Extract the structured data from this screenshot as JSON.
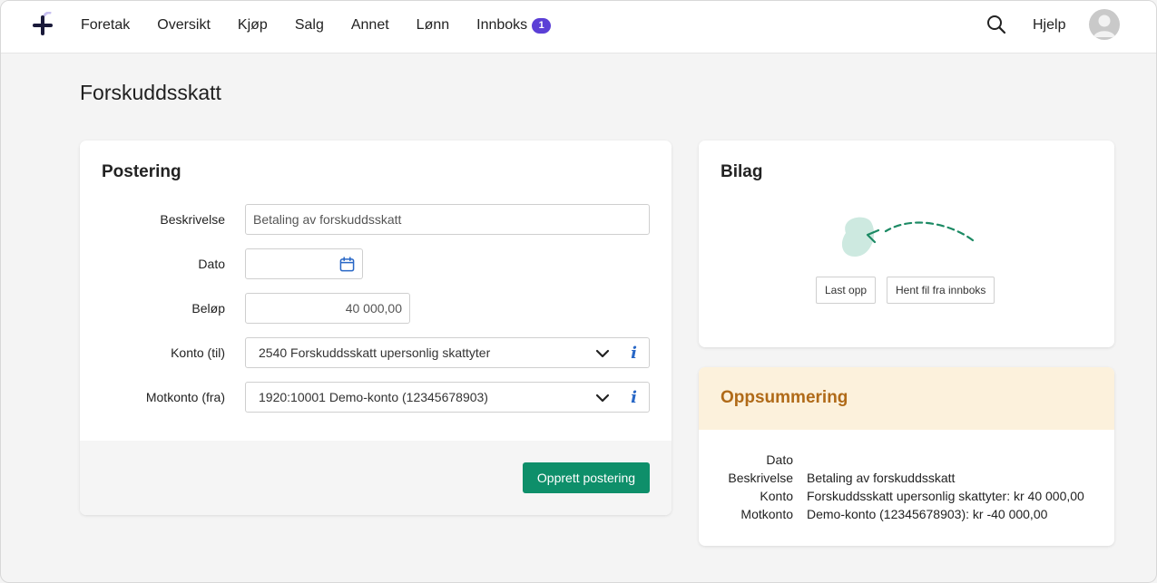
{
  "nav": {
    "items": [
      {
        "label": "Foretak"
      },
      {
        "label": "Oversikt"
      },
      {
        "label": "Kjøp"
      },
      {
        "label": "Salg"
      },
      {
        "label": "Annet"
      },
      {
        "label": "Lønn"
      },
      {
        "label": "Innboks",
        "badge": "1"
      }
    ],
    "help_label": "Hjelp"
  },
  "page": {
    "title": "Forskuddsskatt"
  },
  "postering": {
    "title": "Postering",
    "fields": {
      "beskrivelse_label": "Beskrivelse",
      "beskrivelse_value": "Betaling av forskuddsskatt",
      "dato_label": "Dato",
      "dato_value": "",
      "belop_label": "Beløp",
      "belop_value": "40 000,00",
      "konto_label": "Konto (til)",
      "konto_value": "2540 Forskuddsskatt upersonlig skattyter",
      "motkonto_label": "Motkonto (fra)",
      "motkonto_value": "1920:10001 Demo-konto (12345678903)"
    },
    "submit_label": "Opprett postering"
  },
  "bilag": {
    "title": "Bilag",
    "upload_label": "Last opp",
    "fetch_label": "Hent fil fra innboks"
  },
  "oppsummering": {
    "title": "Oppsummering",
    "rows": [
      {
        "label": "Dato",
        "value": ""
      },
      {
        "label": "Beskrivelse",
        "value": "Betaling av forskuddsskatt"
      },
      {
        "label": "Konto",
        "value": "Forskuddsskatt upersonlig skattyter: kr 40 000,00"
      },
      {
        "label": "Motkonto",
        "value": "Demo-konto (12345678903): kr -40 000,00"
      }
    ]
  },
  "colors": {
    "primary": "#0e8f6a",
    "badge": "#5b3fd6",
    "summary_header_bg": "#fcf1dc",
    "summary_title": "#b06a18",
    "info_icon": "#2867c6"
  }
}
